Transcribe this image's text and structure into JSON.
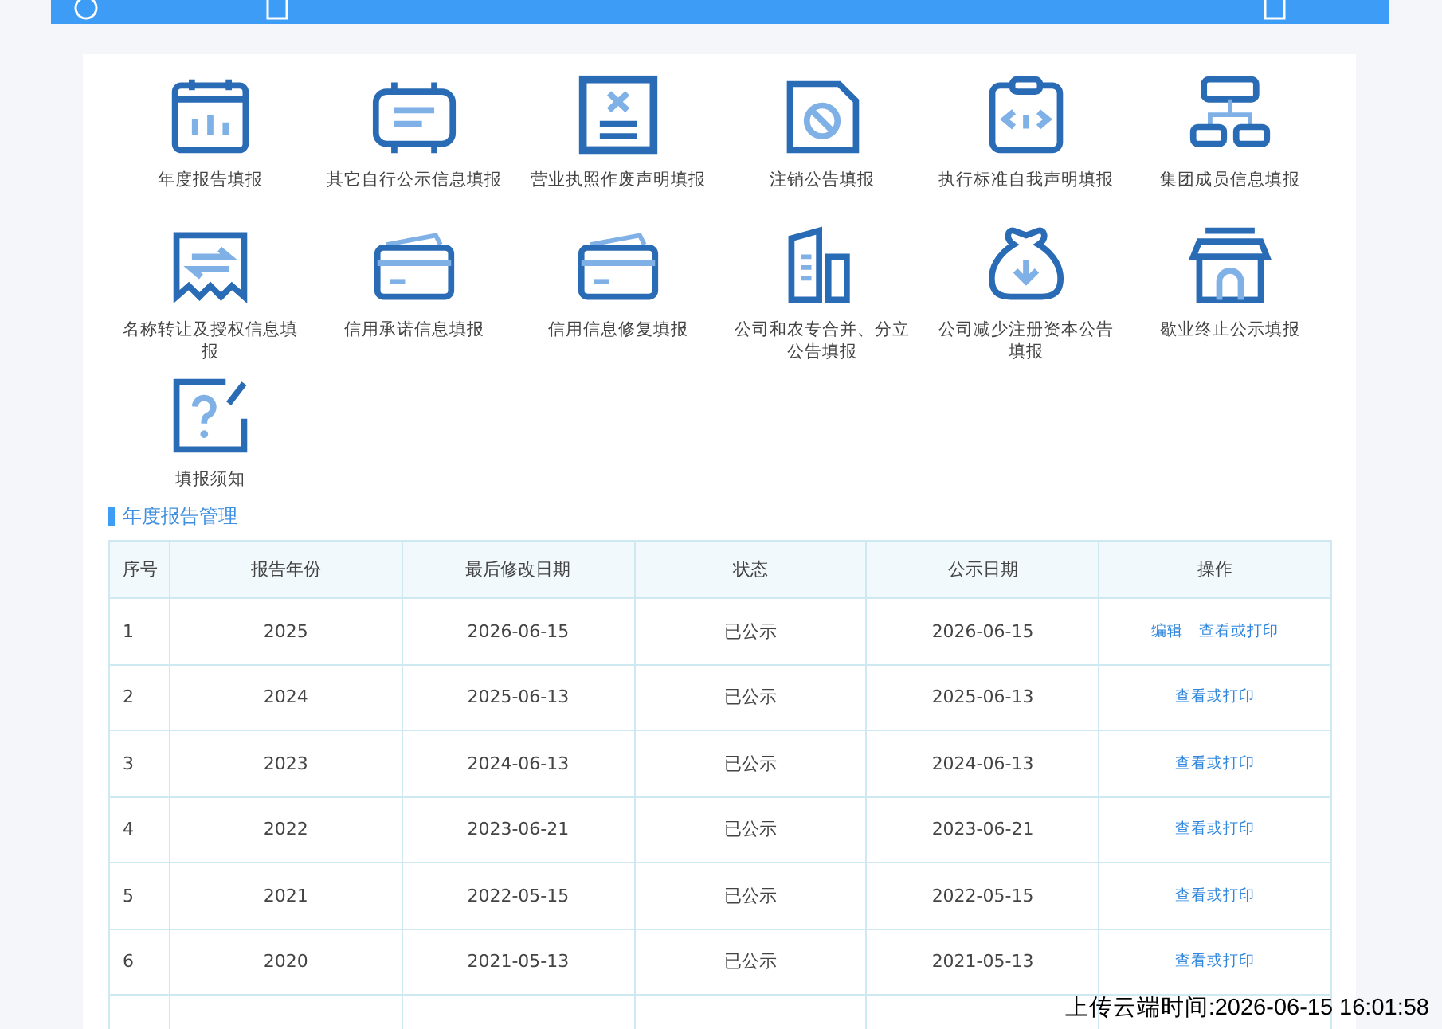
{
  "services": [
    {
      "label": "年度报告填报"
    },
    {
      "label": "其它自行公示信息填报"
    },
    {
      "label": "营业执照作废声明填报"
    },
    {
      "label": "注销公告填报"
    },
    {
      "label": "执行标准自我声明填报"
    },
    {
      "label": "集团成员信息填报"
    },
    {
      "label": "名称转让及授权信息填报"
    },
    {
      "label": "信用承诺信息填报"
    },
    {
      "label": "信用信息修复填报"
    },
    {
      "label": "公司和农专合并、分立公告填报"
    },
    {
      "label": "公司减少注册资本公告填报"
    },
    {
      "label": "歇业终止公示填报"
    },
    {
      "label": "填报须知"
    }
  ],
  "section_title": "年度报告管理",
  "table": {
    "columns": [
      "序号",
      "报告年份",
      "最后修改日期",
      "状态",
      "公示日期",
      "操作"
    ],
    "rows": [
      {
        "cells": [
          "1",
          "2025",
          "2026-06-15",
          "已公示",
          "2026-06-15"
        ],
        "actions": [
          "编辑",
          "查看或打印"
        ]
      },
      {
        "cells": [
          "2",
          "2024",
          "2025-06-13",
          "已公示",
          "2025-06-13"
        ],
        "actions": [
          "查看或打印"
        ]
      },
      {
        "cells": [
          "3",
          "2023",
          "2024-06-13",
          "已公示",
          "2024-06-13"
        ],
        "actions": [
          "查看或打印"
        ]
      },
      {
        "cells": [
          "4",
          "2022",
          "2023-06-21",
          "已公示",
          "2023-06-21"
        ],
        "actions": [
          "查看或打印"
        ]
      },
      {
        "cells": [
          "5",
          "2021",
          "2022-05-15",
          "已公示",
          "2022-05-15"
        ],
        "actions": [
          "查看或打印"
        ]
      },
      {
        "cells": [
          "6",
          "2020",
          "2021-05-13",
          "已公示",
          "2021-05-13"
        ],
        "actions": [
          "查看或打印"
        ]
      }
    ]
  },
  "upload_time": "上传云端时间:2026-06-15 16:01:58"
}
